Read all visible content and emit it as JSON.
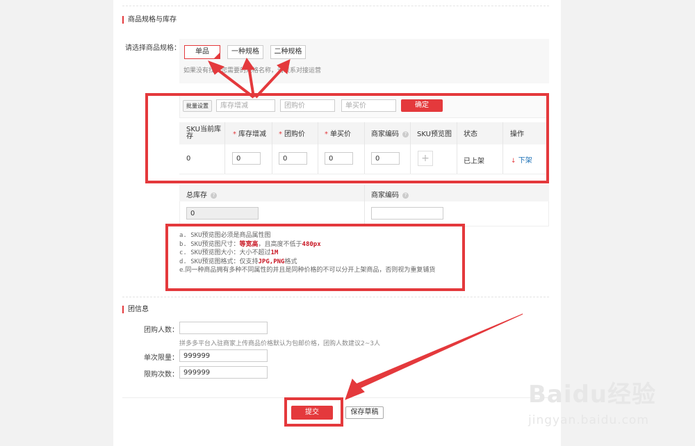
{
  "section_spec": {
    "title": "商品规格与库存"
  },
  "spec_select": {
    "label": "请选择商品规格：",
    "options": [
      "单品",
      "一种规格",
      "二种规格"
    ],
    "hint": "如果没有找到您需要的规格名称，请联系对接运营"
  },
  "batch": {
    "label": "批量设置",
    "stock_placeholder": "库存增减",
    "group_price_placeholder": "团购价",
    "single_price_placeholder": "单买价",
    "confirm": "确定"
  },
  "sku_table": {
    "headers": [
      "SKU当前库存",
      "库存增减",
      "团购价",
      "单买价",
      "商家编码",
      "SKU预览图",
      "状态",
      "操作"
    ],
    "required_headers": [
      "库存增减",
      "团购价",
      "单买价"
    ],
    "row": {
      "current_stock": "0",
      "stock_change": "0",
      "group_price": "0",
      "single_price": "0",
      "merchant_code": "0",
      "status": "已上架",
      "action": "下架"
    }
  },
  "summary": {
    "total_stock_label": "总库存",
    "total_stock_value": "0",
    "merchant_code_label": "商家编码",
    "merchant_code_value": ""
  },
  "notes": {
    "a_prefix": "a. SKU预览图必须是商品属性图",
    "b_prefix": "b. SKU预览图尺寸：",
    "b_hl1": "等宽高",
    "b_mid": "，且高度不低于",
    "b_hl2": "480px",
    "c_prefix": "c. SKU预览图大小：大小不超过",
    "c_hl": "1M",
    "d_prefix": "d. SKU预览图格式：仅支持",
    "d_hl": "JPG,PNG",
    "d_suffix": "格式",
    "e": "e.同一种商品拥有多种不同属性的并且是同种价格的不可以分开上架商品，否则视为重复铺货"
  },
  "section_group": {
    "title": "团信息"
  },
  "group": {
    "size_label": "团购人数：",
    "size_value": "",
    "size_hint": "拼多多平台入驻商家上传商品价格默认为包邮价格，团购人数建议2~3人",
    "limit_once_label": "单次限量：",
    "limit_once_value": "999999",
    "limit_times_label": "限购次数：",
    "limit_times_value": "999999"
  },
  "footer": {
    "submit": "提交",
    "save_draft": "保存草稿"
  },
  "watermark": {
    "brand": "Baidu经验",
    "url": "jingyan.baidu.com"
  },
  "colors": {
    "accent": "#e4393c",
    "annotation": "#e4393c"
  },
  "icons": {
    "plus": "plus-icon",
    "help": "question-icon",
    "down_arrow": "arrow-down-icon"
  }
}
